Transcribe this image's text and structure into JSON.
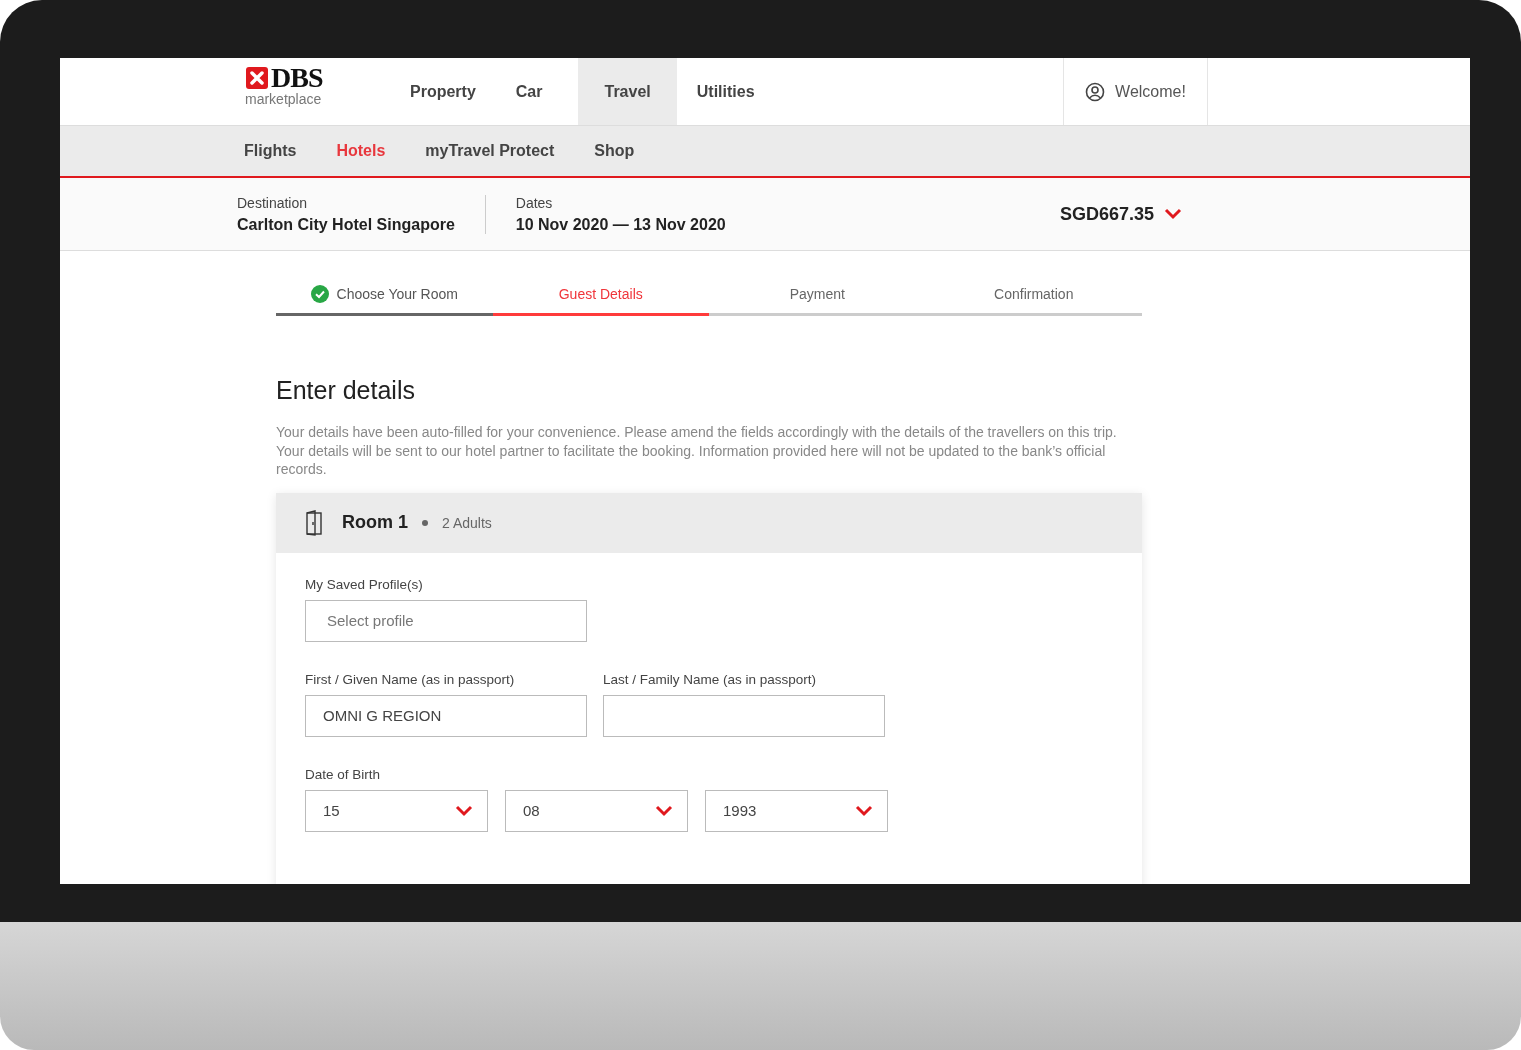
{
  "header": {
    "logo": {
      "brand": "DBS",
      "sub": "marketplace"
    },
    "nav": [
      {
        "label": "Property",
        "selected": false
      },
      {
        "label": "Car",
        "selected": false
      },
      {
        "label": "Travel",
        "selected": true
      },
      {
        "label": "Utilities",
        "selected": false
      }
    ],
    "account": {
      "label": "Welcome!"
    }
  },
  "subnav": [
    {
      "label": "Flights",
      "selected": false
    },
    {
      "label": "Hotels",
      "selected": true
    },
    {
      "label": "myTravel Protect",
      "selected": false
    },
    {
      "label": "Shop",
      "selected": false
    }
  ],
  "summary": {
    "fields": [
      {
        "label": "Destination",
        "value": "Carlton City Hotel Singapore"
      },
      {
        "label": "Dates",
        "value": "10 Nov 2020 — 13 Nov 2020"
      }
    ],
    "price": "SGD667.35"
  },
  "steps": [
    {
      "label": "Choose Your Room",
      "completed": true,
      "selected": false
    },
    {
      "label": "Guest Details",
      "completed": false,
      "selected": true
    },
    {
      "label": "Payment",
      "completed": false,
      "selected": false
    },
    {
      "label": "Confirmation",
      "completed": false,
      "selected": false
    }
  ],
  "heading": "Enter details",
  "intro": "Your details have been auto-filled for your convenience. Please amend the fields accordingly with the details of the travellers on this trip. Your details will be sent to our hotel partner to facilitate the booking. Information provided here will not be updated to the bank’s official records.",
  "room": {
    "title": "Room 1",
    "guests": "2 Adults",
    "rows": [
      {
        "fields": [
          {
            "kind": "text",
            "label": "My Saved Profile(s)",
            "placeholder": "Select profile"
          }
        ]
      },
      {
        "fields": [
          {
            "kind": "text",
            "label": "First / Given Name (as in passport)",
            "value": "OMNI G REGION"
          },
          {
            "kind": "text",
            "label": "Last / Family Name (as in passport)"
          }
        ]
      },
      {
        "kind": "date",
        "label": "Date of Birth",
        "selects": [
          "15",
          "08",
          "1993"
        ]
      }
    ]
  }
}
